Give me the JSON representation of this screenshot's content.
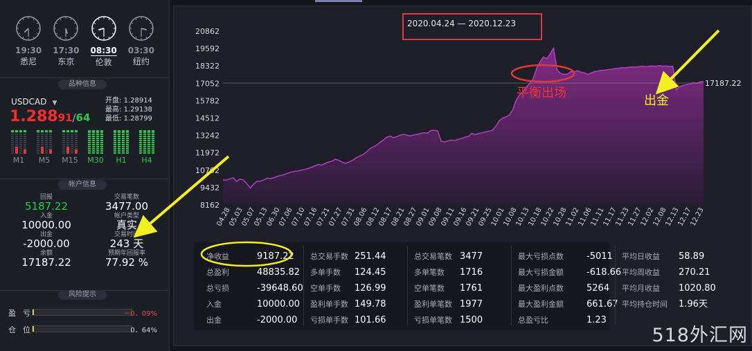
{
  "clocks": [
    {
      "time": "19:30",
      "city": "悉尼",
      "h": 7.5,
      "m": 30,
      "active": false
    },
    {
      "time": "17:30",
      "city": "东京",
      "h": 5.5,
      "m": 30,
      "active": false
    },
    {
      "time": "08:30",
      "city": "伦敦",
      "h": 8.5,
      "m": 30,
      "active": true
    },
    {
      "time": "03:30",
      "city": "纽约",
      "h": 3.5,
      "m": 30,
      "active": false
    }
  ],
  "symbol_section_title": "品种信息",
  "symbol": {
    "name": "USDCAD",
    "bid_big": "1.288",
    "bid_small": "91",
    "slash": "/",
    "ask": "64",
    "open_label": "开盘:",
    "open": "1.28914",
    "high_label": "最高:",
    "high": "1.29138",
    "low_label": "最低:",
    "low": "1.28799"
  },
  "timeframes": [
    {
      "label": "M1",
      "green": false
    },
    {
      "label": "M5",
      "green": false
    },
    {
      "label": "M15",
      "green": false
    },
    {
      "label": "M30",
      "green": true
    },
    {
      "label": "H1",
      "green": true
    },
    {
      "label": "H4",
      "green": true
    }
  ],
  "account_section_title": "帐户信息",
  "account_left": [
    {
      "k": "回报",
      "v": "5187.22",
      "green": true
    },
    {
      "k": "入金",
      "v": "10000.00",
      "green": false
    },
    {
      "k": "出金",
      "v": "-2000.00",
      "green": false
    },
    {
      "k": "余额",
      "v": "17187.22",
      "green": false
    }
  ],
  "account_right": [
    {
      "k": "交易笔数",
      "v": "3477.00"
    },
    {
      "k": "帐户类型",
      "v": "真实"
    },
    {
      "k": "交易时间",
      "v": "243 天"
    },
    {
      "k": "预期年回报率",
      "v": "77.92 %"
    }
  ],
  "risk_section_title": "风险提示",
  "risk": [
    {
      "label": "盈亏",
      "pct": "－0．09%",
      "color": "#e84a4a"
    },
    {
      "label": "仓位",
      "pct": "0．64%",
      "color": "#d0d1d6"
    }
  ],
  "chart_data": {
    "type": "area",
    "title": "2020.04.24 — 2020.12.23",
    "yticks": [
      "20862",
      "19592",
      "18322",
      "17052",
      "15782",
      "14512",
      "13242",
      "11972",
      "10702",
      "9432",
      "8162"
    ],
    "ylim": [
      8162,
      20862
    ],
    "xticks": [
      "04.28",
      "05.03",
      "05.07",
      "05.13",
      "06.30",
      "07.06",
      "07.10",
      "07.16",
      "07.21",
      "07.27",
      "07.31",
      "08.06",
      "08.12",
      "08.17",
      "08.21",
      "08.27",
      "09.01",
      "09.08",
      "09.11",
      "09.16",
      "09.21",
      "09.25",
      "10.01",
      "10.08",
      "10.13",
      "10.18",
      "10.22",
      "10.28",
      "11.02",
      "11.06",
      "11.11",
      "11.17",
      "11.23",
      "11.27",
      "12.02",
      "12.08",
      "12.13",
      "12.17",
      "12.23"
    ],
    "last_value": "17187.22",
    "annotation_exit": "平衡出场",
    "annotation_withdraw": "出金",
    "values": [
      10000,
      9980,
      10050,
      10150,
      9870,
      10050,
      9990,
      9720,
      9400,
      9680,
      9890,
      9900,
      10000,
      10120,
      10080,
      10160,
      10250,
      10320,
      10380,
      10480,
      10550,
      10620,
      10640,
      10700,
      10760,
      10820,
      10920,
      11020,
      11120,
      11080,
      11200,
      11300,
      11360,
      11500,
      11420,
      11280,
      11200,
      11300,
      11420,
      11600,
      11720,
      11830,
      12000,
      12250,
      12380,
      12520,
      12720,
      12900,
      13100,
      13200,
      13080,
      13150,
      13260,
      13320,
      13260,
      13200,
      13280,
      13320,
      13380,
      13440,
      13400,
      13600,
      13620,
      13580,
      12820,
      12760,
      12840,
      12900,
      12860,
      12960,
      13020,
      13120,
      13160,
      13400,
      13300,
      13380,
      13440,
      13500,
      13560,
      13600,
      13900,
      14300,
      14500,
      14600,
      14720,
      15100,
      15800,
      16200,
      16420,
      16780,
      17050,
      17380,
      18120,
      18600,
      18980,
      18850,
      19200,
      19620,
      18050,
      17780,
      17700,
      17720,
      17900,
      17880,
      17980,
      17870,
      17820,
      17700,
      17800,
      17900,
      17950,
      18000,
      18010,
      18050,
      18080,
      18120,
      18140,
      18200,
      18180,
      18220,
      18250,
      18230,
      18270,
      18300,
      18260,
      18300,
      18320,
      18290,
      18340,
      18300,
      18320,
      18280,
      18290,
      16550,
      16800,
      16900,
      16950,
      17000,
      17100,
      17050,
      17150,
      17187.22
    ]
  },
  "stats_columns": [
    [
      {
        "k": "净收益",
        "v": "9187.22"
      },
      {
        "k": "总盈利",
        "v": "48835.82"
      },
      {
        "k": "总亏损",
        "v": "-39648.60"
      },
      {
        "k": "入金",
        "v": "10000.00"
      },
      {
        "k": "出金",
        "v": "-2000.00"
      }
    ],
    [
      {
        "k": "总交易手数",
        "v": "251.44"
      },
      {
        "k": "多单手数",
        "v": "124.45"
      },
      {
        "k": "空单手数",
        "v": "126.99"
      },
      {
        "k": "盈利单手数",
        "v": "149.78"
      },
      {
        "k": "亏损单手数",
        "v": "101.66"
      }
    ],
    [
      {
        "k": "总交易笔数",
        "v": "3477"
      },
      {
        "k": "多单笔数",
        "v": "1716"
      },
      {
        "k": "空单笔数",
        "v": "1761"
      },
      {
        "k": "盈利单笔数",
        "v": "1977"
      },
      {
        "k": "亏损单笔数",
        "v": "1500"
      }
    ],
    [
      {
        "k": "最大亏损点数",
        "v": "-5011"
      },
      {
        "k": "最大亏损金额",
        "v": "-618.66"
      },
      {
        "k": "最大盈利点数",
        "v": "5264"
      },
      {
        "k": "最大盈利金额",
        "v": "661.67"
      },
      {
        "k": "总盈亏比",
        "v": "1.23"
      }
    ],
    [
      {
        "k": "平均日收益",
        "v": "58.89"
      },
      {
        "k": "平均周收益",
        "v": "270.21"
      },
      {
        "k": "平均月收益",
        "v": "1020.80"
      },
      {
        "k": "平均持仓时间",
        "v": "1.96天"
      }
    ]
  ],
  "watermark": "518外汇网",
  "colors": {
    "line": "#b040c0",
    "accent_red": "#e03a3a",
    "annotation_yellow": "#f2ef22",
    "up_green": "#2ec84a"
  }
}
